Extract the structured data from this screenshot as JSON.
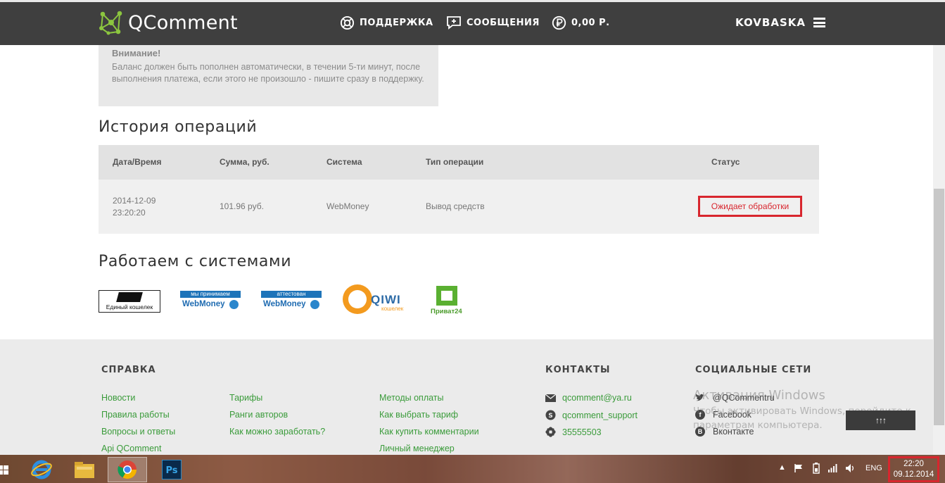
{
  "header": {
    "logo_text": "QComment",
    "nav": [
      {
        "label": "ПОДДЕРЖКА",
        "icon": "lifebuoy-icon"
      },
      {
        "label": "СООБЩЕНИЯ",
        "icon": "message-plus-icon"
      },
      {
        "label": "0,00 Р.",
        "icon": "ruble-coin-icon"
      }
    ],
    "username": "KOVBASKA",
    "menu_icon": "hamburger-menu-icon"
  },
  "notice": {
    "title": "Внимание!",
    "text": "Баланс должен быть пополнен автоматически, в течении 5-ти минут, после выполнения платежа, если этого не произошло - пишите сразу в поддержку."
  },
  "history": {
    "title": "История операций",
    "columns": [
      "Дата/Время",
      "Сумма, руб.",
      "Система",
      "Тип операции",
      "Статус"
    ],
    "rows": [
      {
        "date": "2014-12-09",
        "time": "23:20:20",
        "amount": "101.96 руб.",
        "system": "WebMoney",
        "type": "Вывод средств",
        "status": "Ожидает обработки"
      }
    ]
  },
  "partners": {
    "title": "Работаем с системами",
    "logos": [
      {
        "name": "edinyi-koshelek",
        "text": "Единый кошелек"
      },
      {
        "name": "webmoney-accepted",
        "top": "мы принимаем",
        "text": "WebMoney"
      },
      {
        "name": "webmoney-attested",
        "top": "аттестован",
        "text": "WebMoney"
      },
      {
        "name": "qiwi",
        "text": "QIWI",
        "sub": "кошелек"
      },
      {
        "name": "privat24",
        "text": "Приват24"
      }
    ]
  },
  "footer": {
    "help_title": "СПРАВКА",
    "help_col1": [
      "Новости",
      "Правила работы",
      "Вопросы и ответы",
      "Api QComment"
    ],
    "help_col2": [
      "Тарифы",
      "Ранги авторов",
      "Как можно заработать?"
    ],
    "help_col3": [
      "Методы оплаты",
      "Как выбрать тариф",
      "Как купить комментарии",
      "Личный менеджер"
    ],
    "contacts_title": "КОНТАКТЫ",
    "contacts": [
      {
        "icon": "mail-icon",
        "text": "qcomment@ya.ru"
      },
      {
        "icon": "skype-icon",
        "text": "qcomment_support"
      },
      {
        "icon": "icq-flower-icon",
        "text": "35555503"
      }
    ],
    "social_title": "СОЦИАЛЬНЫЕ СЕТИ",
    "social": [
      {
        "icon": "twitter-icon",
        "text": "@QCommentru"
      },
      {
        "icon": "facebook-icon",
        "glyph": "f",
        "text": "Facebook"
      },
      {
        "icon": "vk-icon",
        "glyph": "B",
        "text": "Вконтакте"
      }
    ],
    "up_button": "↑↑↑"
  },
  "watermark": {
    "line1": "Активация Windows",
    "line2": "Чтобы активировать Windows, перейдите к",
    "line3": "параметрам компьютера."
  },
  "taskbar": {
    "lang": "ENG",
    "time": "22:20",
    "date": "09.12.2014"
  },
  "colors": {
    "header_bg": "#3f3f3f",
    "link_green": "#3a9b3a",
    "status_red": "#d8262e"
  }
}
